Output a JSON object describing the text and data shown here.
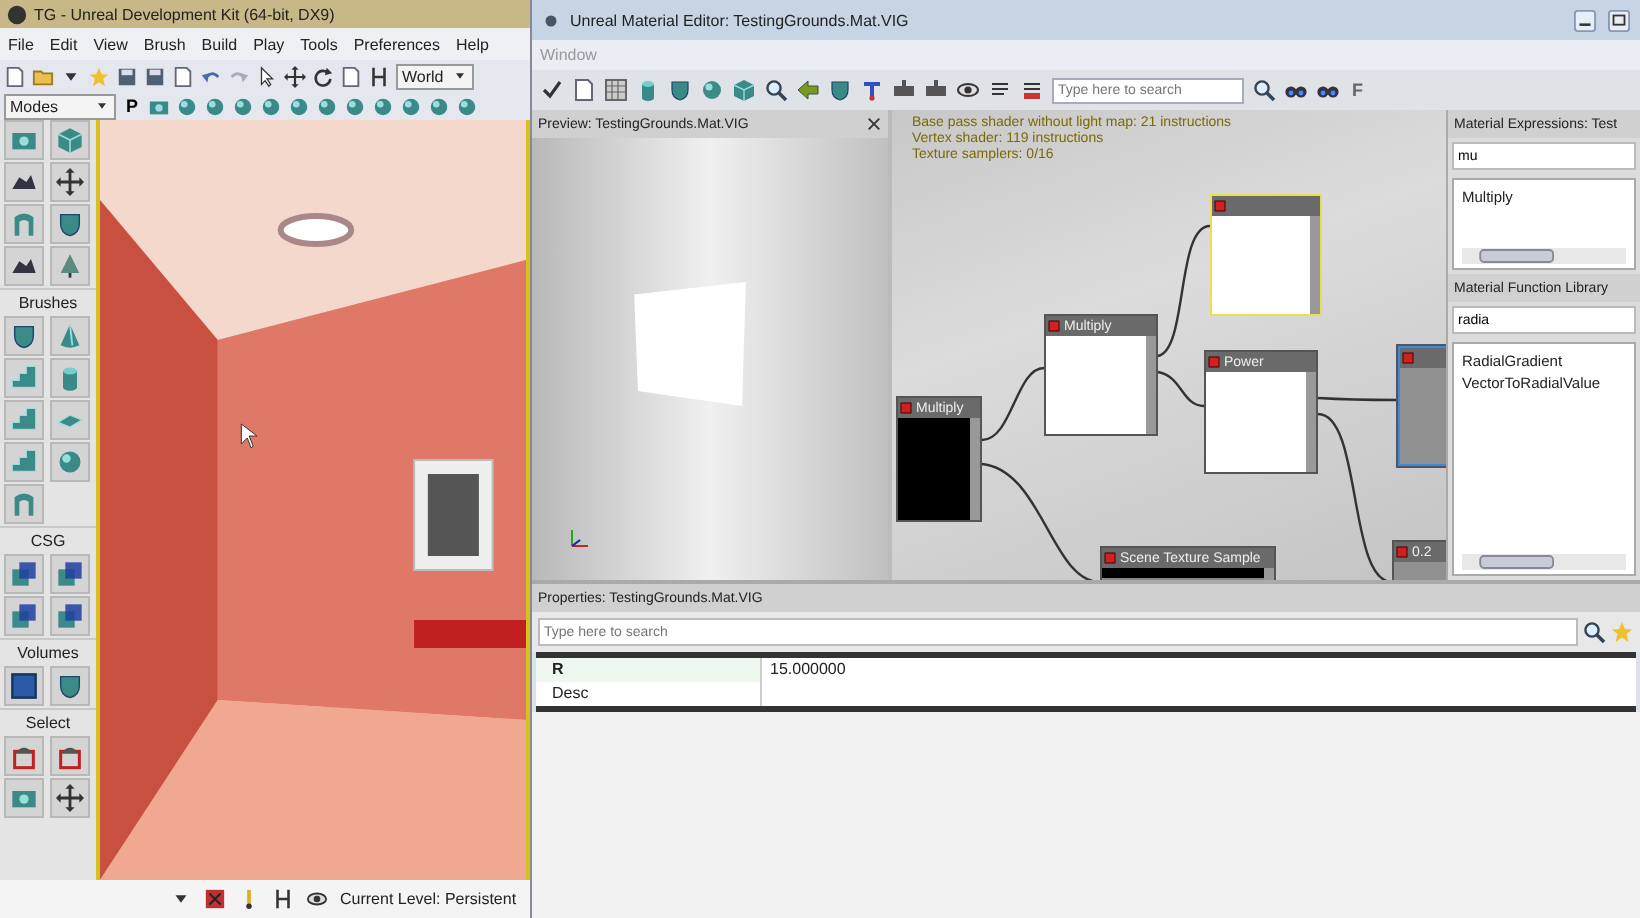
{
  "udk_window": {
    "title": "TG - Unreal Development Kit (64-bit, DX9)",
    "menu": [
      "File",
      "Edit",
      "View",
      "Brush",
      "Build",
      "Play",
      "Tools",
      "Preferences",
      "Help"
    ],
    "coordinate_system": "World",
    "modes_dropdown": "Modes",
    "mode_letter": "P",
    "tool_sections": [
      {
        "title": "Brushes"
      },
      {
        "title": "CSG"
      },
      {
        "title": "Volumes"
      },
      {
        "title": "Select"
      }
    ],
    "status_bar": {
      "current_level": "Current Level: Persistent"
    }
  },
  "material_editor": {
    "title": "Unreal Material Editor: TestingGrounds.Mat.VIG",
    "menu": [
      "Window"
    ],
    "search": {
      "placeholder": "Type here to search"
    },
    "toolbar_letter": "F",
    "preview": {
      "title": "Preview: TestingGrounds.Mat.VIG"
    },
    "graph": {
      "stats": [
        "Base pass shader without light map: 21 instructions",
        "Vertex shader: 119 instructions",
        "Texture samplers: 0/16"
      ],
      "nodes": [
        {
          "title": "Multiply",
          "kind": "black",
          "selected": false,
          "focused": false
        },
        {
          "title": "Multiply",
          "kind": "white",
          "selected": false,
          "focused": false
        },
        {
          "kind": "white",
          "selected": true,
          "focused": false
        },
        {
          "title": "Power",
          "kind": "white",
          "selected": false,
          "focused": false
        },
        {
          "kind": "gray",
          "selected": false,
          "focused": true
        },
        {
          "title": "Scene Texture Sample",
          "kind": "bar",
          "selected": false,
          "focused": false
        },
        {
          "title": "0.2",
          "kind": "gray",
          "selected": false,
          "focused": false
        }
      ]
    },
    "expressions_panel": {
      "title": "Material Expressions: Test",
      "filter": "mu",
      "items": [
        "Multiply"
      ]
    },
    "function_library": {
      "title": "Material Function Library",
      "filter": "radia",
      "items": [
        "RadialGradient",
        "VectorToRadialValue"
      ]
    },
    "properties": {
      "title": "Properties: TestingGrounds.Mat.VIG",
      "search_placeholder": "Type here to search",
      "rows": [
        {
          "name": "R",
          "value": "15.000000"
        },
        {
          "name": "Desc"
        }
      ]
    }
  }
}
